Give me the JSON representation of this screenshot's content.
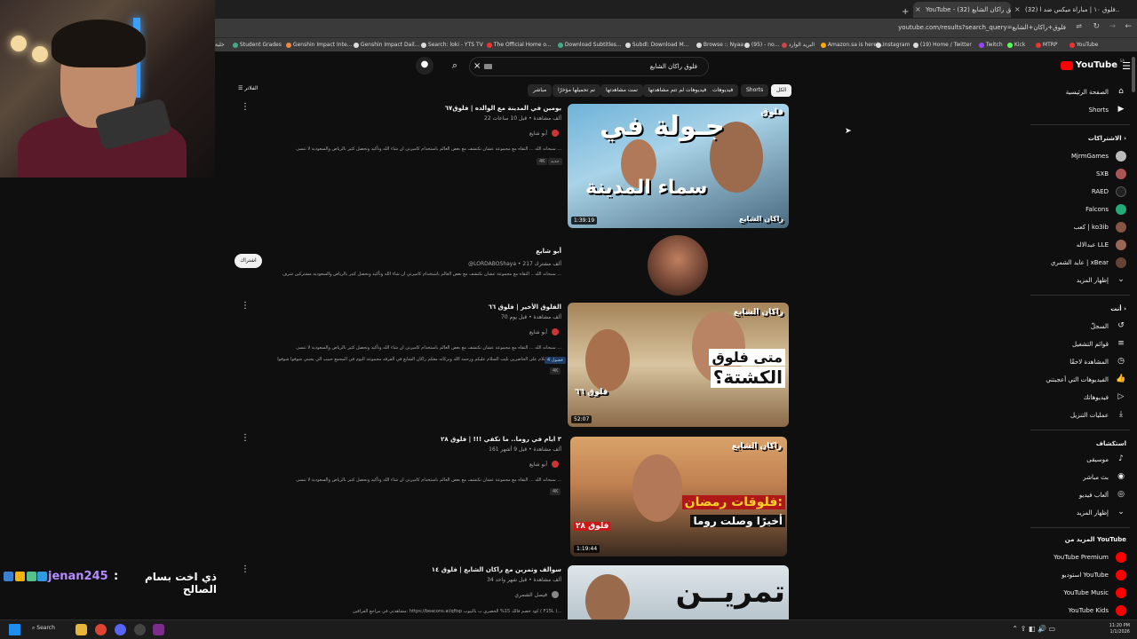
{
  "browser": {
    "tabs": [
      {
        "label": "YouTube - ظليق راكان الشايع (32)",
        "active": true
      },
      {
        "label": "(32) فلوق ١٠ | مباراة ميكس ضد ا...",
        "active": false
      }
    ],
    "new_tab_icon": "plus-icon",
    "url": "youtube.com/results?search_query=فلوق+راكان+الشايع",
    "bookmarks": [
      "Student Grades",
      "Genshin Impact Inte...",
      "Genshin Impact Dail...",
      "Search: loki - YTS TV",
      "The Official Home o...",
      "Download Subtitles...",
      "Subdl: Download M...",
      "Browse :: Nyaa",
      "(95) - no...",
      "البريد الوارد",
      "Amazon.sa is here|...",
      "Instagram",
      "(19) Home / Twitter",
      "Twitch",
      "Kick",
      "MTRP",
      "YouTube"
    ],
    "bookmarks_left_fragment": "خلية"
  },
  "search": {
    "query": "فلوق راكان الشايع",
    "clear_icon": "close-icon",
    "search_icon": "search-icon",
    "mic_icon": "mic-icon"
  },
  "filter_label": "الفلاتر",
  "chips": [
    "الكل",
    "Shorts",
    "فيديوهات",
    "فيديوهات لم تتم مشاهدتها",
    "تمت مشاهدتها",
    "تم تحميلها مؤخرًا",
    "مباشر"
  ],
  "sidebar": {
    "logo": "YouTube",
    "logo_region": "SA",
    "main": [
      {
        "label": "الصفحة الرئيسية",
        "icon": "home-icon"
      },
      {
        "label": "Shorts",
        "icon": "shorts-icon"
      }
    ],
    "subs_heading": "الاشتراكات",
    "subs": [
      {
        "label": "MjrmGames",
        "color": "#bbbbbb"
      },
      {
        "label": "SXB",
        "color": "#aa5555"
      },
      {
        "label": "RAED",
        "color": "#222222"
      },
      {
        "label": "Falcons",
        "color": "#22aa77"
      },
      {
        "label": "كعب | ko3ib",
        "color": "#885544"
      },
      {
        "label": "عبدالاله LLE",
        "color": "#996655"
      },
      {
        "label": "عايد الشمري | xBear",
        "color": "#664433"
      }
    ],
    "subs_more": "إظهار المزيد",
    "you_heading": "أنت",
    "you": [
      {
        "label": "السجلّ",
        "icon": "history-icon"
      },
      {
        "label": "قوائم التشغيل",
        "icon": "playlist-icon"
      },
      {
        "label": "المشاهدة لاحقًا",
        "icon": "clock-icon"
      },
      {
        "label": "الفيديوهات التي أعجبتني",
        "icon": "like-icon"
      },
      {
        "label": "فيديوهاتك",
        "icon": "video-icon"
      },
      {
        "label": "عمليات التنزيل",
        "icon": "download-icon"
      }
    ],
    "explore_heading": "استكشاف",
    "explore": [
      {
        "label": "موسيقى",
        "icon": "music-icon"
      },
      {
        "label": "بث مباشر",
        "icon": "live-icon"
      },
      {
        "label": "ألعاب فيديو",
        "icon": "gaming-icon"
      },
      {
        "label": "إظهار المزيد",
        "icon": "chevron-down-icon"
      }
    ],
    "more_heading": "المزيد من YouTube",
    "more": [
      {
        "label": "YouTube Premium",
        "color": "#ff0000"
      },
      {
        "label": "استوديو YouTube",
        "color": "#ff0000"
      },
      {
        "label": "YouTube Music",
        "color": "#ff0000"
      },
      {
        "label": "YouTube Kids",
        "color": "#ff0000"
      }
    ]
  },
  "results": [
    {
      "title": "يومين في المدينة مع الوالده | فلوق٦٧",
      "meta": "22 ألف مشاهدة • قبل 10 ساعات",
      "channel": "أبو شايع",
      "desc": "سبحانه الله ... التقاه مع مجموعة عشان نكتشف مع بعض العالم باستخدام كاميرتي ان شاء الله وتأكيد ونحصل كثير بالرياض والسعودية لا تنسى ...",
      "badges": [
        "جديد",
        "4K"
      ],
      "duration": "1:39:19",
      "thumb_top": "فلوق",
      "thumb_main": "جـولة في",
      "thumb_sub": "سماء المدينة",
      "thumb_tag": "راكان الشايع"
    },
    {
      "channel_name": "أبو شايع",
      "channel_meta": "@LORDABOShaya • 217 ألف مشترك",
      "channel_desc": "سبحانه الله .. التقاه مع مجموعة عشان نكتشف مع بعض العالم باستخدام كاميرتي ان شاء الله وتأكيد ونحصل كثير بالرياض والسعودية مشتركين شرف ...",
      "subscribe_label": "اشتراك"
    },
    {
      "title": "الفلوق الأخير | فلوق ٦٦",
      "meta": "70 ألف مشاهدة • قبل يوم",
      "channel": "أبو شايع",
      "desc": "سبحانه الله ... التقاه مع مجموعة عشان نكتشف مع بعض العالم باستخدام كاميرتي ان شاء الله وتأكيد ونحصل كثير بالرياض والسعودية لا تنسى ...",
      "desc2": "سلام على الحاضرين تليب السلام عليكم ورحمة الله وبركاته معكم راكان الشايع في الفرقه مجموعة اليوم في المجمع حبيب الي يحبني شوفوا شوفوا !",
      "chapters": "4 فصول",
      "badges": [
        "4K"
      ],
      "duration": "52:07",
      "thumb_top": "راكان الشايع",
      "thumb_main": "متى فلوق",
      "thumb_sub": "الكشتة؟",
      "thumb_num": "فلوق ٦٦"
    },
    {
      "title": "٣ ايام في روما.. ما نكفي !!! | فلوق ٢٨",
      "meta": "161 ألف مشاهدة • قبل 9 أشهر",
      "channel": "أبو شايع",
      "desc": "سبحانه الله ... التقاه مع مجموعة عشان نكتشف مع بعض العالم باستخدام كاميرتي ان شاء الله وتأكيد ونحصل كثير بالرياض والسعودية لا تنسى ...",
      "badges": [
        "4K"
      ],
      "duration": "1:19:44",
      "thumb_top": "راكان الشايع",
      "thumb_main": "فلوقات رمضان:",
      "thumb_sub": "أخيرًا وصلت روما",
      "thumb_num": "فلوق ٢٨"
    },
    {
      "title": "سوالف وتمرين مع راكان الشايع | فلوق ١٤",
      "meta": "34 ألف مشاهدة • قبل شهر واحد",
      "channel": "فيصل الشمري",
      "desc": "مشاهدتي في مراجع الفراقين: https://beacons.ai/qftsp كود خصم فالك 15% الحصري ب بالتيوب ( F15L )...",
      "thumb_main": "تمريــن"
    }
  ],
  "chat": {
    "user": "jenan245",
    "separator": ":",
    "message": "ذي اخت بسام الصالح"
  },
  "taskbar": {
    "search_label": "Search",
    "time": "11:20 PM",
    "date": "1/1/2026"
  }
}
